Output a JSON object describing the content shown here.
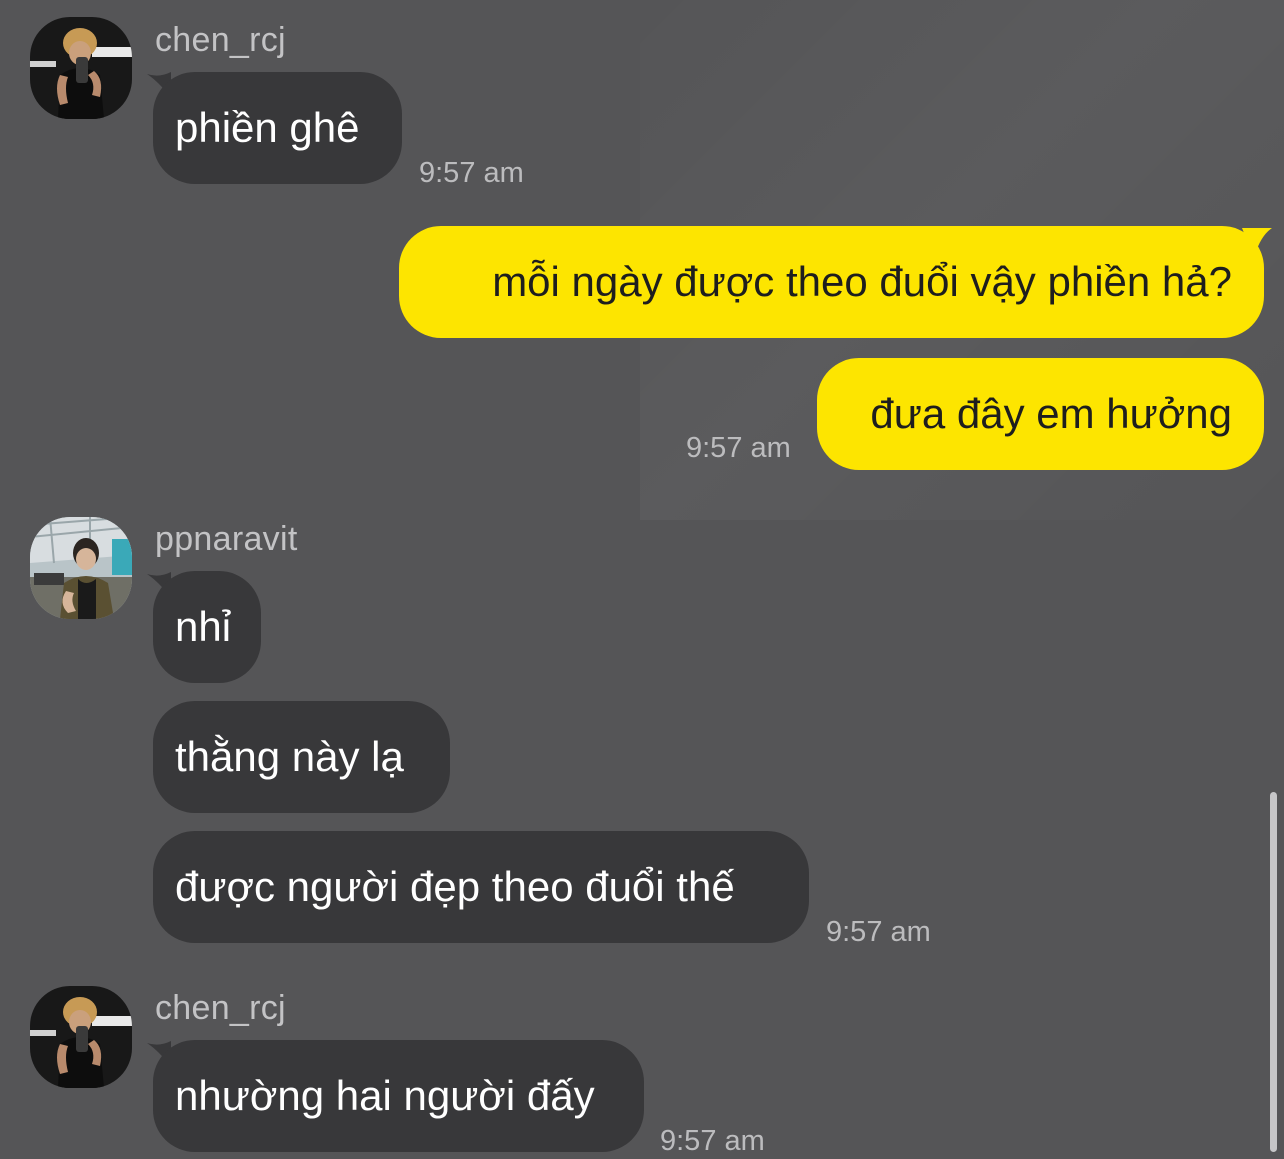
{
  "colors": {
    "background": "#555557",
    "incoming_bubble": "#38383a",
    "outgoing_bubble": "#fde500",
    "timestamp": "#bcbcbe"
  },
  "groups": [
    {
      "sender": "chen_rcj",
      "avatar": "avatar-chen-rcj",
      "messages": [
        {
          "text": "phiền ghê",
          "direction": "incoming"
        }
      ],
      "time": "9:57 am"
    },
    {
      "sender": "",
      "messages": [
        {
          "text": "mỗi ngày được theo đuổi vậy phiền hả?",
          "direction": "outgoing"
        },
        {
          "text": "đưa đây em hưởng",
          "direction": "outgoing"
        }
      ],
      "time": "9:57 am"
    },
    {
      "sender": "ppnaravit",
      "avatar": "avatar-ppnaravit",
      "messages": [
        {
          "text": "nhỉ",
          "direction": "incoming"
        },
        {
          "text": "thằng này lạ",
          "direction": "incoming"
        },
        {
          "text": "được người đẹp theo đuổi thế",
          "direction": "incoming"
        }
      ],
      "time": "9:57 am"
    },
    {
      "sender": "chen_rcj",
      "avatar": "avatar-chen-rcj",
      "messages": [
        {
          "text": "nhường hai người đấy",
          "direction": "incoming"
        }
      ],
      "time": "9:57 am"
    }
  ]
}
